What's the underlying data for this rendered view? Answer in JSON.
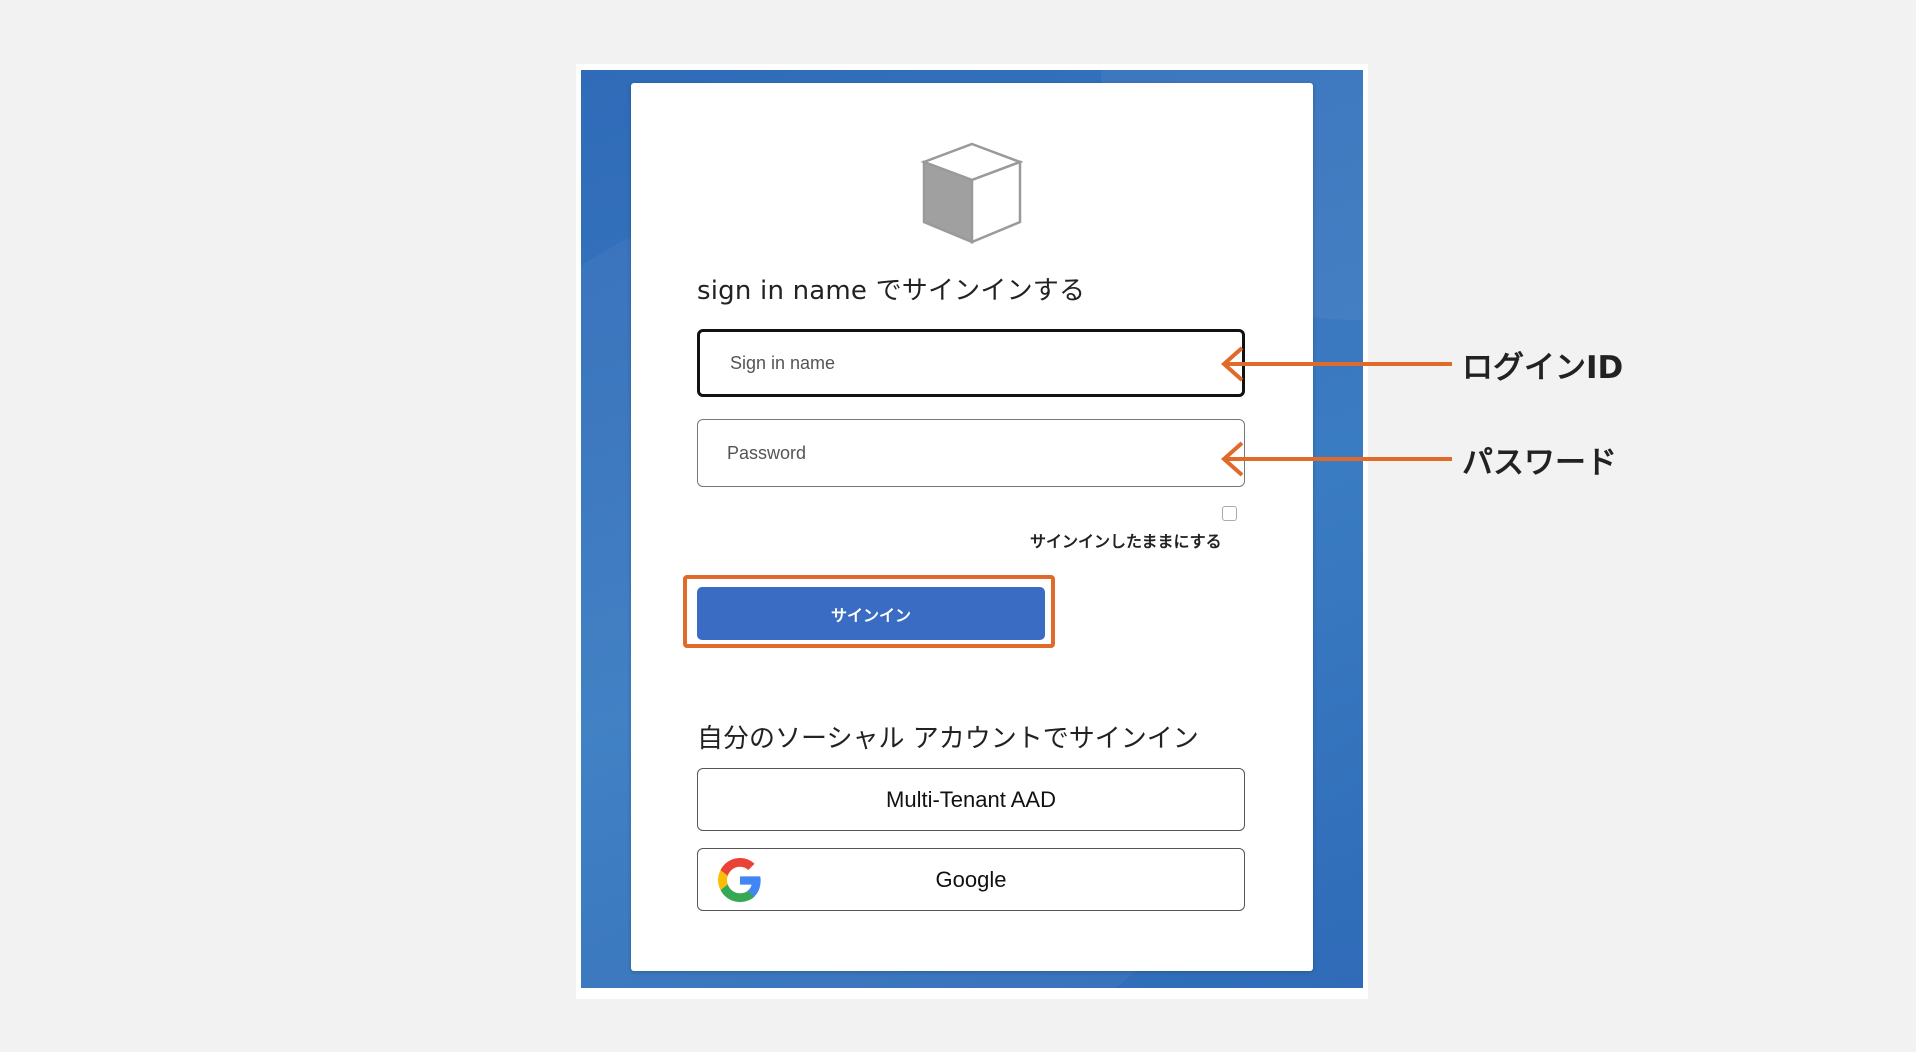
{
  "form": {
    "heading": "sign in name でサインインする",
    "signin_name_placeholder": "Sign in name",
    "password_placeholder": "Password",
    "keep_signed_in_label": "サインインしたままにする",
    "signin_button_label": "サインイン"
  },
  "social": {
    "heading": "自分のソーシャル アカウントでサインイン",
    "providers": [
      {
        "label": "Multi-Tenant AAD"
      },
      {
        "label": "Google"
      }
    ]
  },
  "annotations": {
    "login_id": "ログインID",
    "password": "パスワード"
  },
  "colors": {
    "page_background": "#f2f2f2",
    "tenant_background": "#3072bb",
    "signin_button": "#3a6cc3",
    "annotation_accent": "#e06a2a"
  },
  "icons": {
    "logo": "cube-icon",
    "google": "google-icon"
  }
}
